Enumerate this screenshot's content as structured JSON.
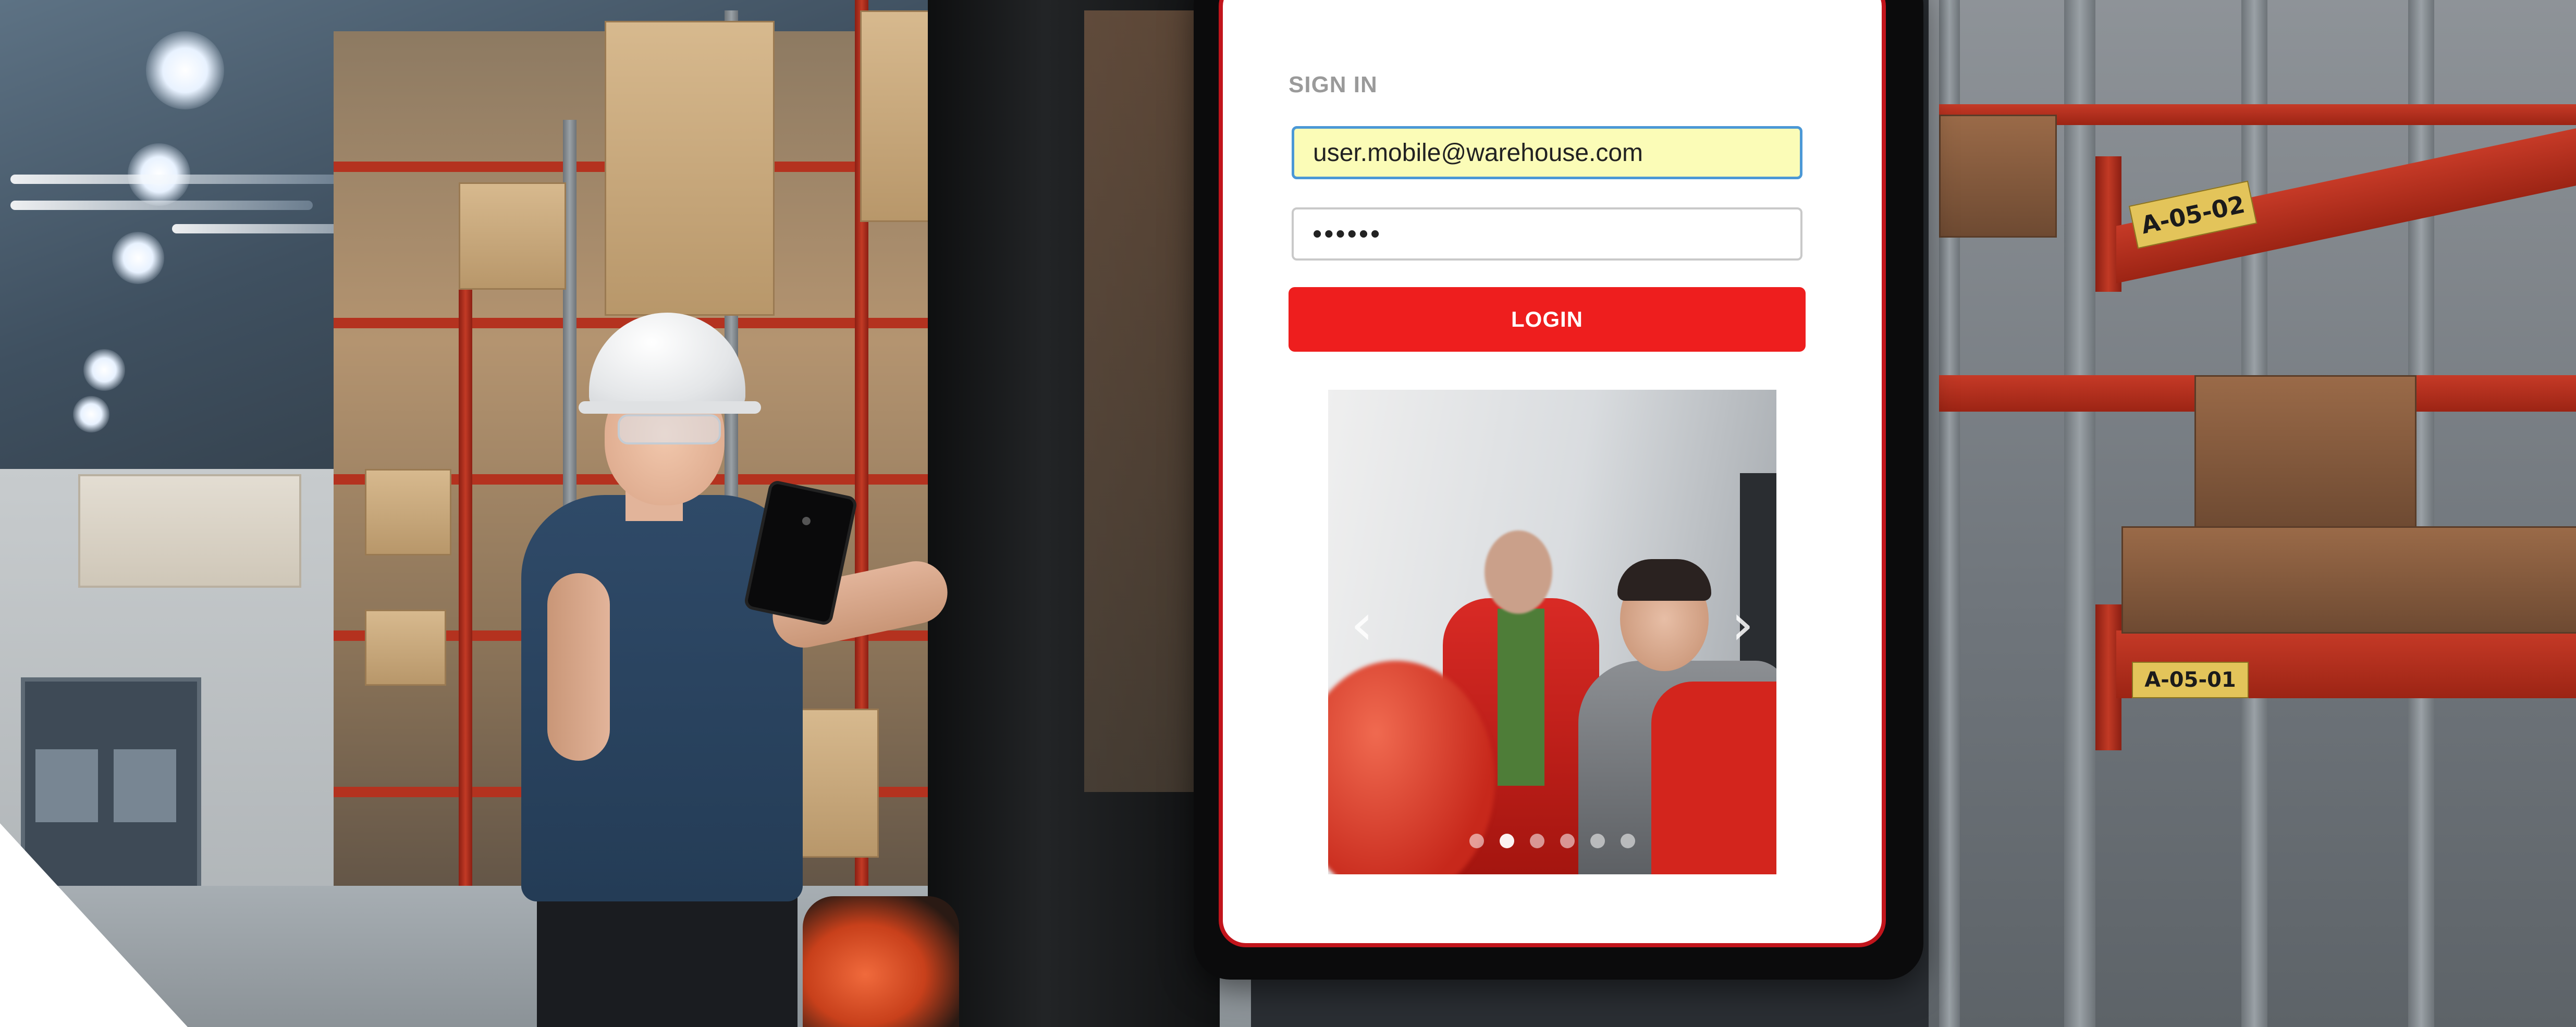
{
  "login": {
    "section_label": "SIGN IN",
    "email_value": "user.mobile@warehouse.com",
    "password_value": "••••••",
    "login_button_label": "LOGIN"
  },
  "carousel": {
    "prev_icon": "chevron-left-icon",
    "next_icon": "chevron-right-icon",
    "prev_glyph": "‹",
    "next_glyph": "›",
    "dot_count": 6,
    "active_dot": 1
  },
  "background": {
    "rack_labels": [
      "A-05-02",
      "A-05-01"
    ]
  },
  "colors": {
    "accent_red": "#ee1e1e",
    "frame_red": "#c2151c",
    "email_fill": "#fbfcb7",
    "email_border": "#4b98d6"
  }
}
